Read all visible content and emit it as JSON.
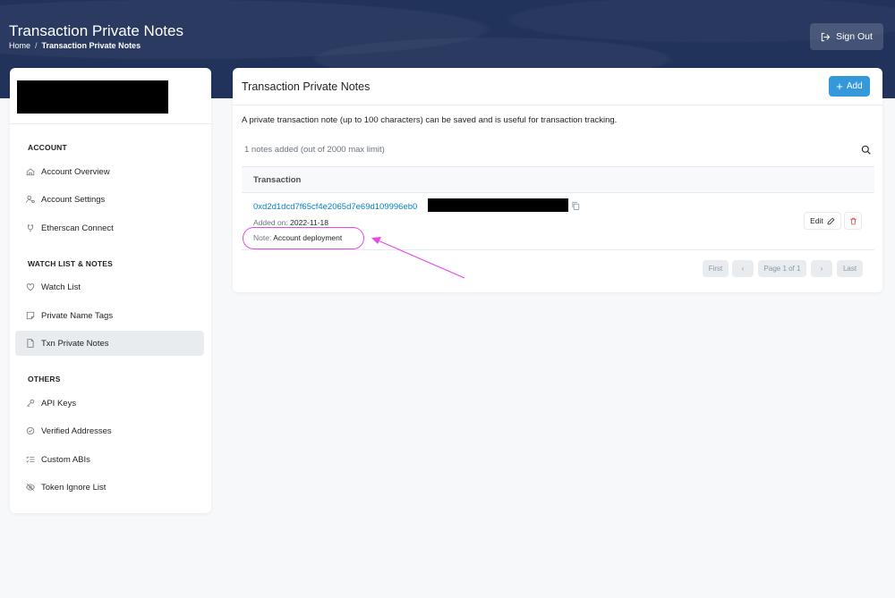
{
  "header": {
    "title": "Transaction Private Notes",
    "breadcrumb": {
      "home": "Home",
      "separator": "/",
      "current": "Transaction Private Notes"
    },
    "signout_label": "Sign Out",
    "bg_color": "#21325b"
  },
  "sidebar": {
    "sections": [
      {
        "title": "ACCOUNT",
        "items": [
          {
            "label": "Account Overview",
            "icon": "home-icon"
          },
          {
            "label": "Account Settings",
            "icon": "user-gear-icon"
          },
          {
            "label": "Etherscan Connect",
            "icon": "connect-icon"
          }
        ]
      },
      {
        "title": "WATCH LIST & NOTES",
        "items": [
          {
            "label": "Watch List",
            "icon": "heart-icon"
          },
          {
            "label": "Private Name Tags",
            "icon": "sticky-note-icon"
          },
          {
            "label": "Txn Private Notes",
            "icon": "file-icon",
            "active": true
          }
        ]
      },
      {
        "title": "OTHERS",
        "items": [
          {
            "label": "API Keys",
            "icon": "key-icon"
          },
          {
            "label": "Verified Addresses",
            "icon": "check-circle-icon"
          },
          {
            "label": "Custom ABIs",
            "icon": "list-check-icon"
          },
          {
            "label": "Token Ignore List",
            "icon": "eye-slash-icon"
          }
        ]
      }
    ]
  },
  "main": {
    "title": "Transaction Private Notes",
    "add_label": "Add",
    "description": "A private transaction note (up to 100 characters) can be saved and is useful for transaction tracking.",
    "count_text": "1 notes added (out of 2000 max limit)",
    "table": {
      "header": "Transaction",
      "rows": [
        {
          "tx_hash": "0xd2d1dcd7f65cf4e2065d7e69d109996eb0",
          "added_on_label": "Added on:",
          "added_on": "2022-11-18",
          "note_label": "Note:",
          "note": "Account deployment",
          "edit_label": "Edit"
        }
      ]
    },
    "pagination": {
      "first": "First",
      "prev": "‹",
      "page": "Page 1 of 1",
      "next": "›",
      "last": "Last"
    }
  },
  "colors": {
    "link": "#0784c3",
    "accent": "#3498db",
    "annotation": "#e64be6",
    "delete": "#de4437"
  }
}
